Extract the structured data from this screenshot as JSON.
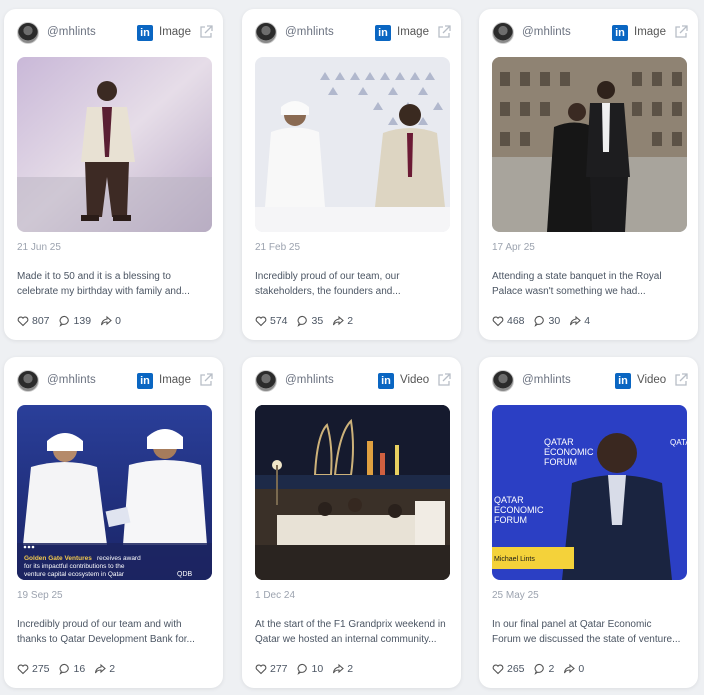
{
  "posts": [
    {
      "handle": "@mhlints",
      "network_icon": "linkedin-icon",
      "type": "Image",
      "date": "21 Jun 25",
      "caption_line1": "Made it to 50 and it is a blessing to",
      "caption_line2": "celebrate my birthday with family and...",
      "likes": "807",
      "comments": "139",
      "shares": "0"
    },
    {
      "handle": "@mhlints",
      "network_icon": "linkedin-icon",
      "type": "Image",
      "date": "21 Feb 25",
      "caption_line1": "Incredibly proud of our team, our",
      "caption_line2": "stakeholders, the founders and...",
      "likes": "574",
      "comments": "35",
      "shares": "2"
    },
    {
      "handle": "@mhlints",
      "network_icon": "linkedin-icon",
      "type": "Image",
      "date": "17 Apr 25",
      "caption_line1": "Attending a state banquet in the Royal",
      "caption_line2": "Palace wasn't something we had...",
      "likes": "468",
      "comments": "30",
      "shares": "4"
    },
    {
      "handle": "@mhlints",
      "network_icon": "linkedin-icon",
      "type": "Image",
      "date": "19 Sep 25",
      "caption_line1": "Incredibly proud of our team and with",
      "caption_line2": "thanks to Qatar Development Bank for...",
      "likes": "275",
      "comments": "16",
      "shares": "2",
      "overlay_brand": "Golden Gate Ventures",
      "overlay_text1": "receives award",
      "overlay_text2": "for its impactful contributions to the",
      "overlay_text3": "venture capital ecosystem in Qatar",
      "overlay_logo": "QDB"
    },
    {
      "handle": "@mhlints",
      "network_icon": "linkedin-icon",
      "type": "Video",
      "date": "1 Dec 24",
      "caption_line1": "At the start of the F1 Grandprix weekend in",
      "caption_line2": "Qatar we hosted an internal community...",
      "likes": "277",
      "comments": "10",
      "shares": "2"
    },
    {
      "handle": "@mhlints",
      "network_icon": "linkedin-icon",
      "type": "Video",
      "date": "25 May 25",
      "caption_line1": "In our final panel at Qatar Economic",
      "caption_line2": "Forum we discussed the state of venture...",
      "likes": "265",
      "comments": "2",
      "shares": "0",
      "overlay_title1": "QATAR",
      "overlay_title2": "ECONOMIC",
      "overlay_title3": "FORUM",
      "overlay_name": "Michael Lints"
    }
  ],
  "colors": {
    "linkedin_blue": "#0a66c2",
    "card_bg": "#ffffff",
    "page_bg": "#eef0f3",
    "muted_text": "#9ca3af"
  }
}
